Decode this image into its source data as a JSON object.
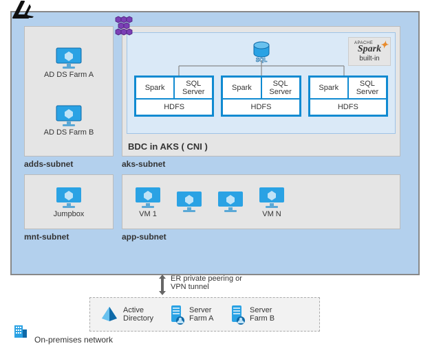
{
  "logo_alt": "Azure",
  "subnets": {
    "adds": {
      "label": "adds-subnet",
      "items": [
        "AD DS Farm A",
        "AD DS Farm B"
      ]
    },
    "aks": {
      "label": "aks-subnet",
      "bdc_label": "BDC in AKS ( CNI )",
      "sql_label": "SQL",
      "spark_apache": "APACHE",
      "spark_word": "Spark",
      "spark_subtitle": "built-in",
      "node": {
        "spark": "Spark",
        "sqlserver": "SQL Server",
        "hdfs": "HDFS"
      },
      "node_count": 3
    },
    "mnt": {
      "label": "mnt-subnet",
      "items": [
        "Jumpbox"
      ]
    },
    "app": {
      "label": "app-subnet",
      "items": [
        "VM 1",
        "",
        "",
        "VM N"
      ]
    }
  },
  "connector": {
    "text": "ER private peering or VPN tunnel"
  },
  "onprem": {
    "label": "On-premises network",
    "items": [
      {
        "name": "Active Directory",
        "icon": "pyramid"
      },
      {
        "name": "Server Farm A",
        "icon": "server"
      },
      {
        "name": "Server Farm B",
        "icon": "server"
      }
    ]
  },
  "icons": {
    "aks": "aks-icon",
    "sql": "sql-icon",
    "building": "building-icon"
  },
  "colors": {
    "region_bg": "#b3d0ed",
    "subnet_bg": "#e5e5e5",
    "bdc_bg": "#dae9f7",
    "node_border": "#0f8ad1",
    "azure_blue": "#0f8ad1"
  }
}
